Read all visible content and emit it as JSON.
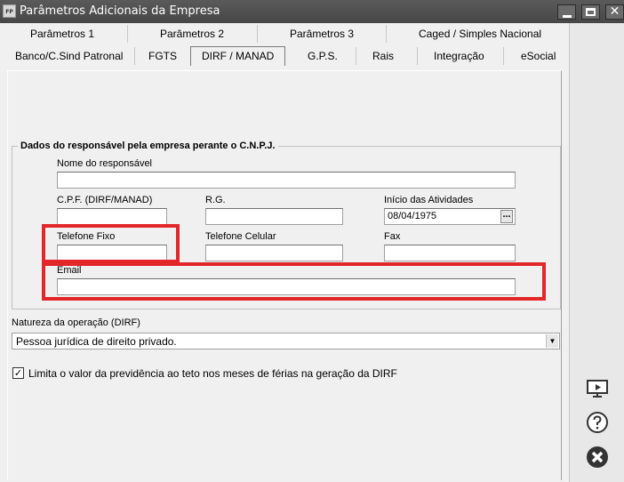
{
  "window": {
    "icon_text": "FP",
    "title": "Parâmetros Adicionais da Empresa",
    "close_glyph": "✕"
  },
  "tabs_row1": [
    "Parâmetros 1",
    "Parâmetros 2",
    "Parâmetros 3",
    "Caged / Simples Nacional"
  ],
  "tabs_row2": [
    "Banco/C.Sind Patronal",
    "FGTS",
    "DIRF / MANAD",
    "G.P.S.",
    "Rais",
    "Integração",
    "eSocial"
  ],
  "group": {
    "legend": "Dados do responsável pela empresa perante o C.N.P.J."
  },
  "fields": {
    "responsavel_label": "Nome do responsável",
    "responsavel_value": "",
    "cpf_label": "C.P.F. (DIRF/MANAD)",
    "cpf_value": "",
    "rg_label": "R.G.",
    "rg_value": "",
    "inicio_label": "Início das Atividades",
    "inicio_value": "08/04/1975",
    "date_button": "…",
    "telefone_fixo_label": "Telefone Fixo",
    "telefone_fixo_value": "",
    "telefone_celular_label": "Telefone Celular",
    "telefone_celular_value": "",
    "fax_label": "Fax",
    "fax_value": "",
    "email_label": "Email",
    "email_value": ""
  },
  "natureza": {
    "label": "Natureza da operação (DIRF)",
    "selected": "Pessoa jurídica de direito privado.",
    "arrow": "▼"
  },
  "checkbox": {
    "checked_glyph": "✓",
    "label": "Limita o valor da previdência ao teto nos meses de férias na geração da DIRF"
  },
  "highlight_color": "#e3262a"
}
